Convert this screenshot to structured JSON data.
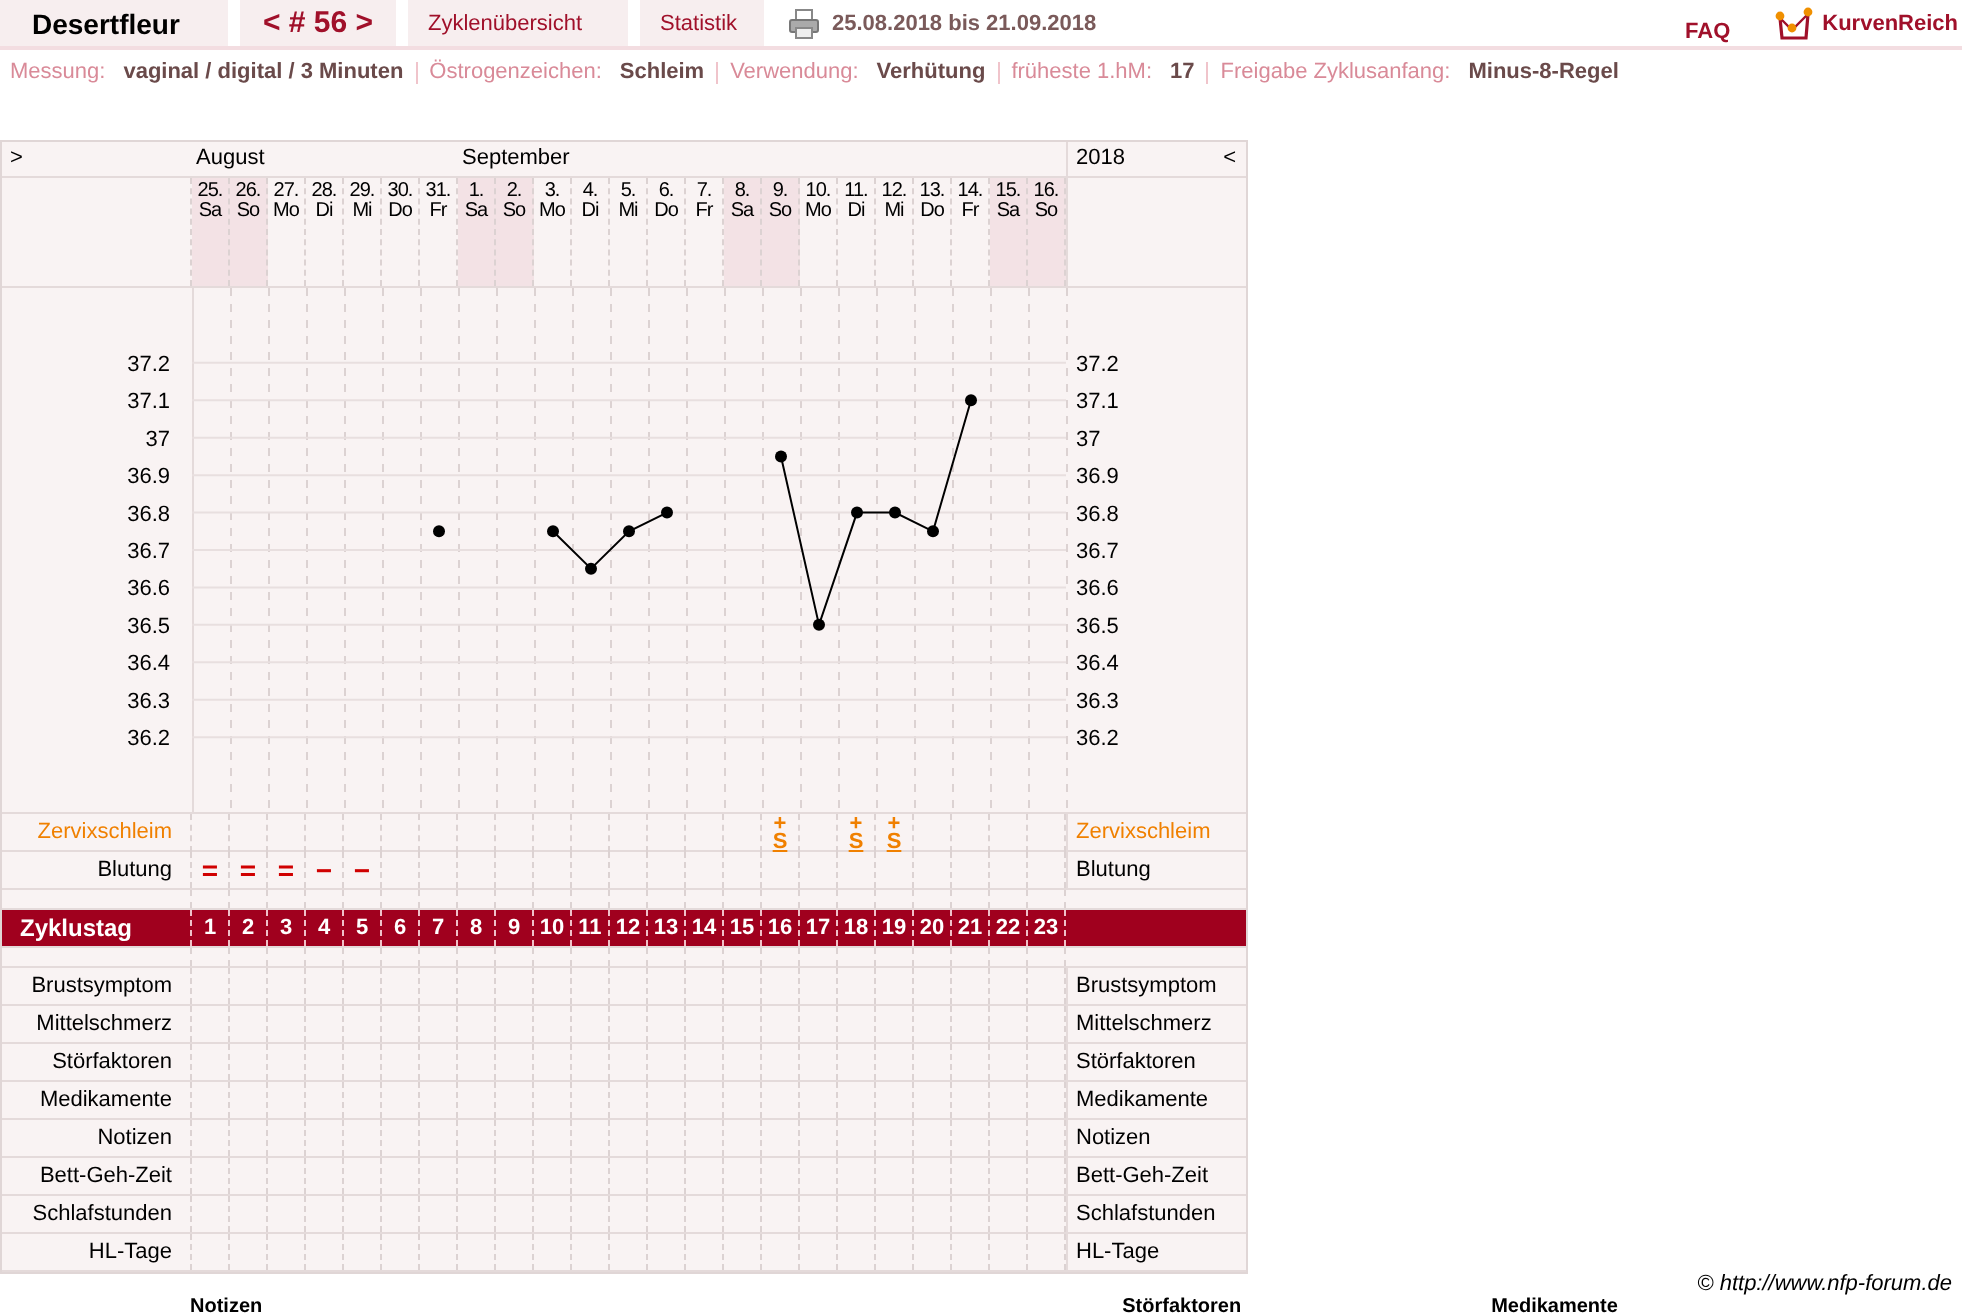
{
  "header": {
    "title": "Desertfleur",
    "cycle_nav": "< # 56 >",
    "tabs": [
      {
        "label": "Zyklenübersicht",
        "selected": false
      },
      {
        "label": "Statistik",
        "selected": false
      }
    ],
    "date_range": "25.08.2018 bis 21.09.2018",
    "faq": "FAQ",
    "brand": "KurvenReich"
  },
  "info": [
    {
      "label": "Messung:",
      "value": "vaginal / digital / 3 Minuten"
    },
    {
      "label": "Östrogenzeichen:",
      "value": "Schleim"
    },
    {
      "label": "Verwendung:",
      "value": "Verhütung"
    },
    {
      "label": "früheste 1.hM:",
      "value": "17"
    },
    {
      "label": "Freigabe Zyklusanfang:",
      "value": "Minus-8-Regel"
    }
  ],
  "table": {
    "prev_button": ">",
    "next_button": "<",
    "year": "2018",
    "months": [
      {
        "label": "August",
        "days": [
          {
            "date": "25.",
            "weekday": "Sa",
            "weekend": true,
            "cycle_day": "1",
            "bleeding": "="
          },
          {
            "date": "26.",
            "weekday": "So",
            "weekend": true,
            "cycle_day": "2",
            "bleeding": "="
          },
          {
            "date": "27.",
            "weekday": "Mo",
            "weekend": false,
            "cycle_day": "3",
            "bleeding": "="
          },
          {
            "date": "28.",
            "weekday": "Di",
            "weekend": false,
            "cycle_day": "4",
            "bleeding": "−"
          },
          {
            "date": "29.",
            "weekday": "Mi",
            "weekend": false,
            "cycle_day": "5",
            "bleeding": "−"
          },
          {
            "date": "30.",
            "weekday": "Do",
            "weekend": false,
            "cycle_day": "6"
          },
          {
            "date": "31.",
            "weekday": "Fr",
            "weekend": false,
            "cycle_day": "7"
          }
        ]
      },
      {
        "label": "September",
        "days": [
          {
            "date": "1.",
            "weekday": "Sa",
            "weekend": true,
            "cycle_day": "8"
          },
          {
            "date": "2.",
            "weekday": "So",
            "weekend": true,
            "cycle_day": "9"
          },
          {
            "date": "3.",
            "weekday": "Mo",
            "weekend": false,
            "cycle_day": "10"
          },
          {
            "date": "4.",
            "weekday": "Di",
            "weekend": false,
            "cycle_day": "11"
          },
          {
            "date": "5.",
            "weekday": "Mi",
            "weekend": false,
            "cycle_day": "12"
          },
          {
            "date": "6.",
            "weekday": "Do",
            "weekend": false,
            "cycle_day": "13"
          },
          {
            "date": "7.",
            "weekday": "Fr",
            "weekend": false,
            "cycle_day": "14"
          },
          {
            "date": "8.",
            "weekday": "Sa",
            "weekend": true,
            "cycle_day": "15"
          },
          {
            "date": "9.",
            "weekday": "So",
            "weekend": true,
            "cycle_day": "16",
            "mucus": {
              "symbol": "S",
              "modifier": "+"
            }
          },
          {
            "date": "10.",
            "weekday": "Mo",
            "weekend": false,
            "cycle_day": "17"
          },
          {
            "date": "11.",
            "weekday": "Di",
            "weekend": false,
            "cycle_day": "18",
            "mucus": {
              "symbol": "S",
              "modifier": "+"
            }
          },
          {
            "date": "12.",
            "weekday": "Mi",
            "weekend": false,
            "cycle_day": "19",
            "mucus": {
              "symbol": "S",
              "modifier": "+"
            }
          },
          {
            "date": "13.",
            "weekday": "Do",
            "weekend": false,
            "cycle_day": "20"
          },
          {
            "date": "14.",
            "weekday": "Fr",
            "weekend": false,
            "cycle_day": "21"
          },
          {
            "date": "15.",
            "weekday": "Sa",
            "weekend": true,
            "cycle_day": "22"
          },
          {
            "date": "16.",
            "weekday": "So",
            "weekend": true,
            "cycle_day": "23"
          }
        ]
      }
    ],
    "chart": {
      "chart_data": {
        "type": "line",
        "grid": true,
        "ylim": [
          36.0,
          37.4
        ],
        "yticks": [
          37.2,
          37.1,
          37,
          36.9,
          36.8,
          36.7,
          36.6,
          36.5,
          36.4,
          36.3,
          36.2
        ],
        "series": [
          {
            "color": "#000000",
            "marker": true,
            "values": [
              null,
              null,
              null,
              null,
              null,
              null,
              36.75,
              null,
              null,
              36.75,
              36.65,
              36.75,
              36.8,
              null,
              null,
              36.95,
              36.5,
              36.8,
              36.8,
              36.75,
              37.1,
              null,
              null
            ]
          }
        ]
      },
      "right_tick_labels": [
        "37.2",
        "37.1",
        "37",
        "36.9",
        "36.8",
        "36.7",
        "36.6",
        "36.5",
        "36.4",
        "36.3",
        "36.2"
      ]
    },
    "mucus_row": {
      "label_left": "Zervixschleim",
      "label_right": "Zervixschleim"
    },
    "bleeding_row": {
      "label_left": "Blutung",
      "label_right": "Blutung"
    },
    "cycle_day_label": "Zyklustag",
    "rows": [
      {
        "label_left": "Brustsymptom",
        "label_right": "Brustsymptom"
      },
      {
        "label_left": "Mittelschmerz",
        "label_right": "Mittelschmerz"
      },
      {
        "label_left": "Störfaktoren",
        "label_right": "Störfaktoren"
      },
      {
        "label_left": "Medikamente",
        "label_right": "Medikamente"
      },
      {
        "label_left": "Notizen",
        "label_right": "Notizen"
      },
      {
        "label_left": "Bett-Geh-Zeit",
        "label_right": "Bett-Geh-Zeit"
      },
      {
        "label_left": "Schlafstunden",
        "label_right": "Schlafstunden"
      },
      {
        "label_left": "HL-Tage",
        "label_right": "HL-Tage"
      }
    ]
  },
  "copyright": "© http://www.nfp-forum.de",
  "bottom_headings": [
    "Notizen",
    "Störfaktoren",
    "Medikamente"
  ]
}
